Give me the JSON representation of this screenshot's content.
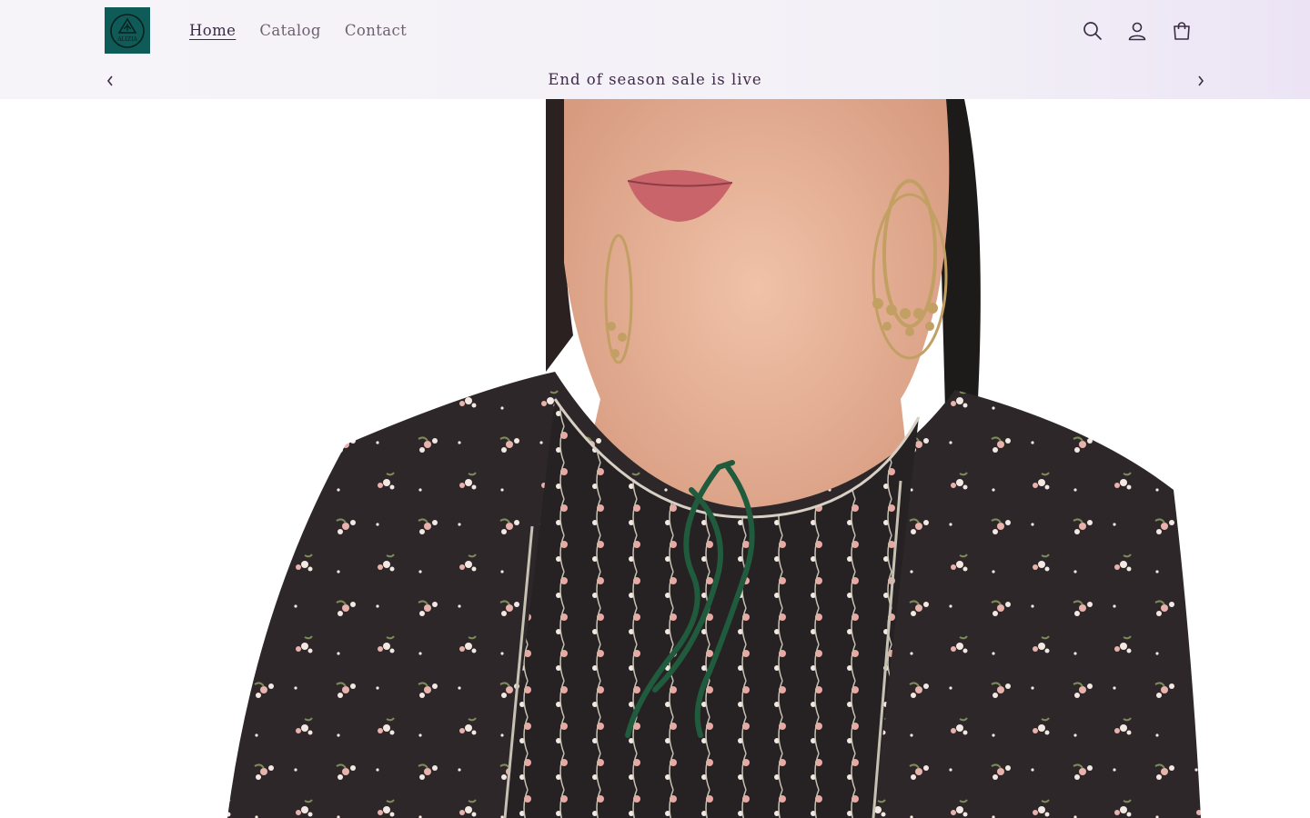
{
  "brand": {
    "logo_text": "ALIZIA",
    "logo_color": "#0f5b57"
  },
  "nav": {
    "items": [
      {
        "label": "Home",
        "active": true
      },
      {
        "label": "Catalog",
        "active": false
      },
      {
        "label": "Contact",
        "active": false
      }
    ]
  },
  "header_icons": [
    "search-icon",
    "account-icon",
    "cart-icon"
  ],
  "announcement": {
    "text": "End of season sale is live"
  },
  "hero": {
    "image_alt": "Model wearing black floral printed kurta with green tassel tie and gold chandbali earrings"
  },
  "colors": {
    "text_dark": "#3b2b45",
    "text_muted": "#6d5f70",
    "garment": "#2c2628",
    "tassel": "#1f5b3c",
    "gold": "#c2a063"
  }
}
